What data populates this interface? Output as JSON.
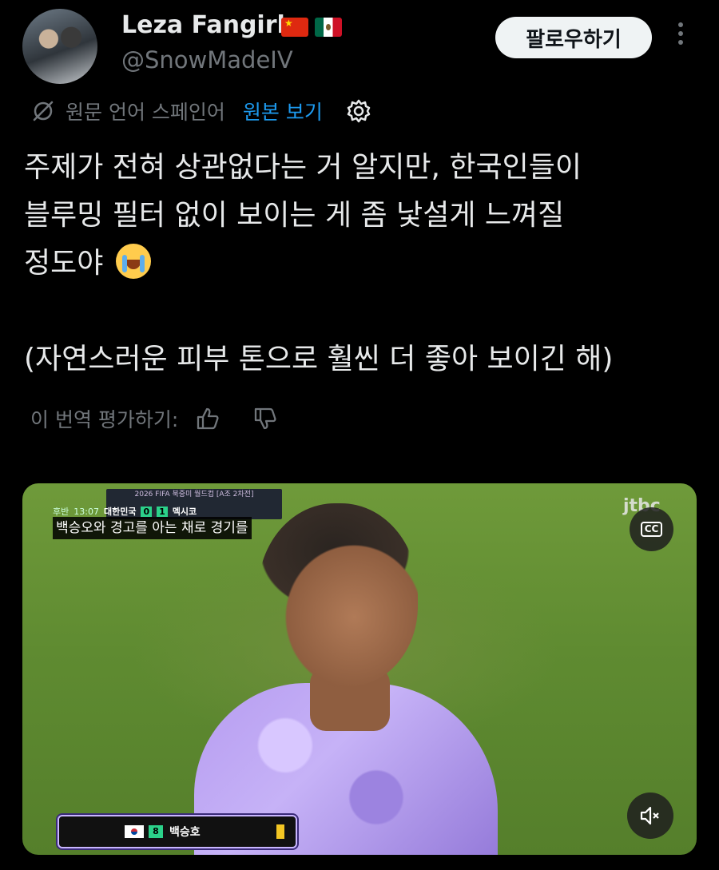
{
  "author": {
    "display_name": "Leza Fangirl",
    "handle": "@SnowMadeIV",
    "flags": [
      "flag-china-icon",
      "flag-mexico-icon"
    ]
  },
  "follow_button": {
    "label": "팔로우하기"
  },
  "translation": {
    "source_language": "원문 언어 스페인어",
    "show_original": "원본 보기"
  },
  "tweet": {
    "lines": [
      "주제가 전혀 상관없다는 거 알지만, 한국인들이",
      "블루밍 필터 없이 보이는 게 좀 낯설게 느껴질",
      "정도야",
      "(자연스러운 피부 톤으로 훨씬 더 좋아 보이긴 해)"
    ],
    "emoji": "loudly-crying-face"
  },
  "rate_translation": {
    "label": "이 번역 평가하기:"
  },
  "media": {
    "scoreboard_title": "2026 FIFA 북중미 월드컵 [A조 2차전]",
    "half": "후반",
    "clock": "13:07",
    "home_team": "대한민국",
    "home_score": "0",
    "away_score": "1",
    "away_team": "멕시코",
    "subtitle": "백승오와 경고를 아는 채로 경기를",
    "broadcaster": "jtbc",
    "cc_label": "CC",
    "player_number": "8",
    "player_name": "백승호"
  },
  "colors": {
    "background": "#000000",
    "text": "#e7e9ea",
    "secondary": "#71767b",
    "link": "#1d9bf0",
    "follow_bg": "#eff3f4"
  }
}
